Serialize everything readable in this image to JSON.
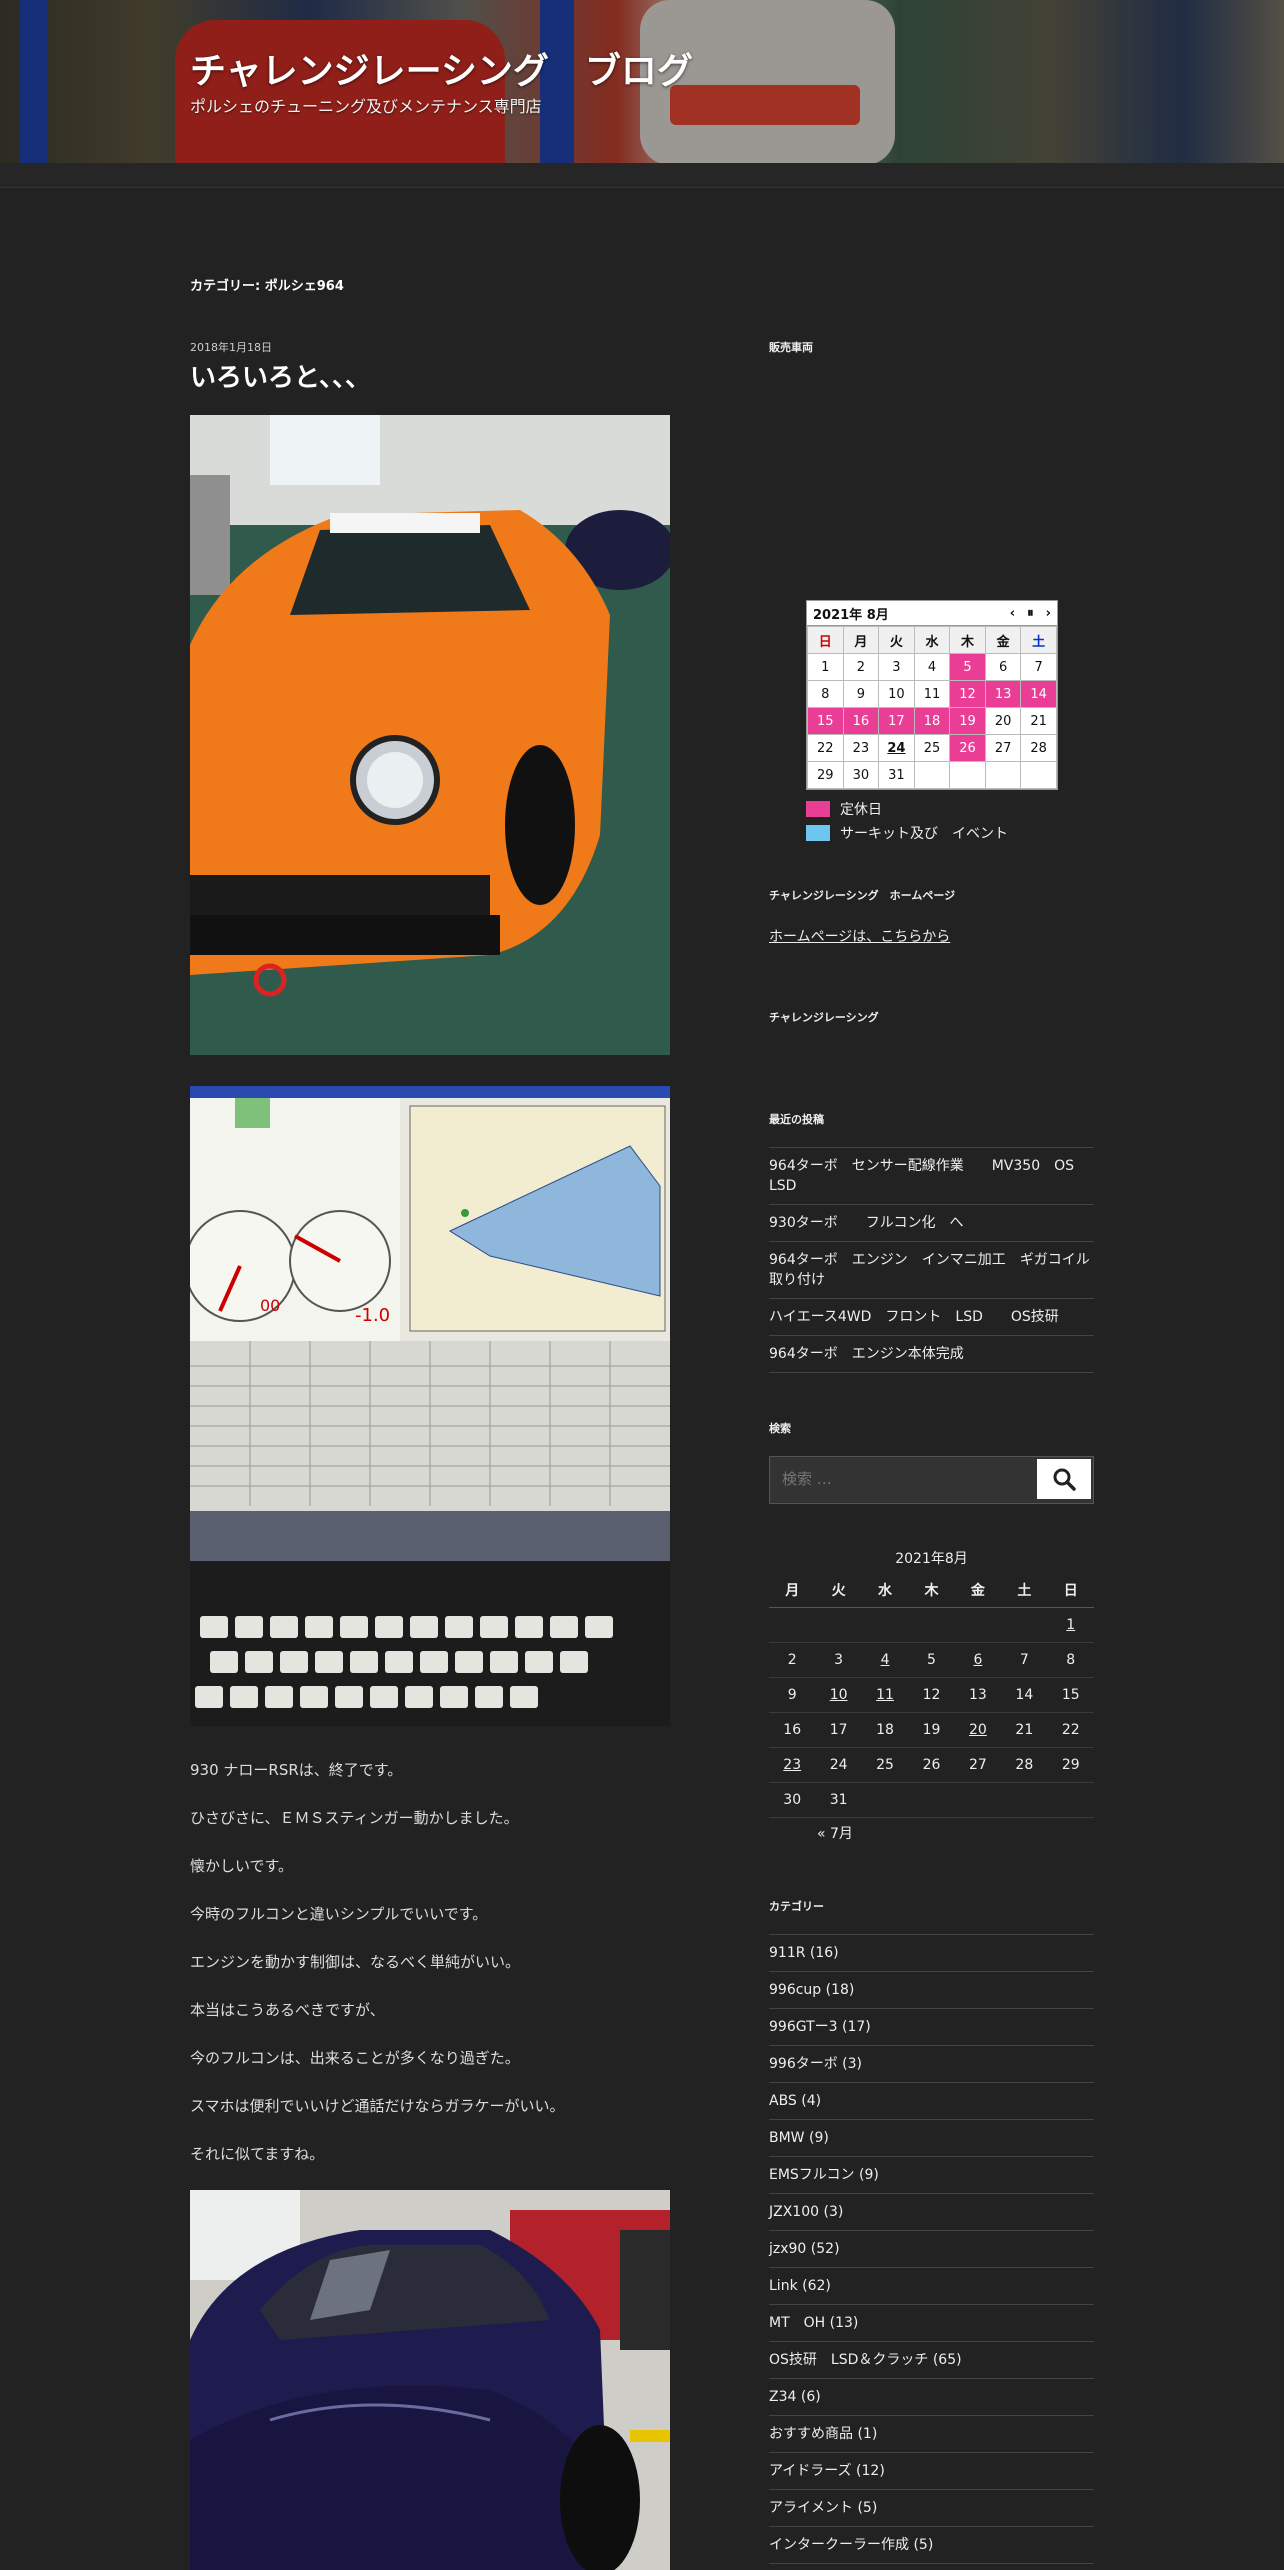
{
  "header": {
    "title": "チャレンジレーシング　ブログ",
    "description": "ポルシェのチューニング及びメンテナンス専門店"
  },
  "archive": {
    "label": "カテゴリー: ポルシェ964"
  },
  "post": {
    "date": "2018年1月18日",
    "title": "いろいろと、、、",
    "paragraphs": [
      "930 ナローRSRは、終了です。",
      "ひさびさに、ＥＭＳスティンガー動かしました。",
      "懐かしいです。",
      "今時のフルコンと違いシンプルでいいです。",
      "エンジンを動かす制御は、なるべく単純がいい。",
      "本当はこうあるべきですが、",
      "今のフルコンは、出来ることが多くなり過ぎた。",
      "スマホは便利でいいけど通話だけならガラケーがいい。",
      "それに似てますね。"
    ]
  },
  "sidebar": {
    "sales_heading": "販売車両",
    "business_calendar": {
      "month_label": "2021年 8月",
      "weekdays": [
        "日",
        "月",
        "火",
        "水",
        "木",
        "金",
        "土"
      ],
      "weeks": [
        [
          "1",
          "2",
          "3",
          "4",
          "5",
          "6",
          "7"
        ],
        [
          "8",
          "9",
          "10",
          "11",
          "12",
          "13",
          "14"
        ],
        [
          "15",
          "16",
          "17",
          "18",
          "19",
          "20",
          "21"
        ],
        [
          "22",
          "23",
          "24",
          "25",
          "26",
          "27",
          "28"
        ],
        [
          "29",
          "30",
          "31",
          "",
          "",
          "",
          ""
        ]
      ],
      "legend": [
        {
          "label": "定休日",
          "color": "#ea3d96"
        },
        {
          "label": "サーキット及び　イベント",
          "color": "#6ec6f0"
        }
      ],
      "holiday_color": "#ea3d96"
    },
    "homepage_heading": "チャレンジレーシング　ホームページ",
    "homepage_link": "ホームページは、こちらから",
    "challenge_heading": "チャレンジレーシング",
    "recent_heading": "最近の投稿",
    "recent_posts": [
      "964ターボ　センサー配線作業　　MV350　OS　LSD",
      "930ターボ　　フルコン化　へ",
      "964ターボ　エンジン　インマニ加工　ギガコイル取り付け",
      "ハイエース4WD　フロント　LSD　　OS技研",
      "964ターボ　エンジン本体完成"
    ],
    "search_heading": "検索",
    "search_placeholder": "検索 …",
    "wp_calendar": {
      "caption": "2021年8月",
      "weekdays": [
        "月",
        "火",
        "水",
        "木",
        "金",
        "土",
        "日"
      ],
      "weeks": [
        [
          "",
          "",
          "",
          "",
          "",
          "",
          "1"
        ],
        [
          "2",
          "3",
          "4",
          "5",
          "6",
          "7",
          "8"
        ],
        [
          "9",
          "10",
          "11",
          "12",
          "13",
          "14",
          "15"
        ],
        [
          "16",
          "17",
          "18",
          "19",
          "20",
          "21",
          "22"
        ],
        [
          "23",
          "24",
          "25",
          "26",
          "27",
          "28",
          "29"
        ],
        [
          "30",
          "31",
          "",
          "",
          "",
          "",
          ""
        ]
      ],
      "linked_days": [
        "1",
        "4",
        "6",
        "10",
        "11",
        "20",
        "23"
      ],
      "prev_link": "« 7月"
    },
    "categories_heading": "カテゴリー",
    "categories": [
      "911R (16)",
      "996cup (18)",
      "996GTー3 (17)",
      "996ターボ (3)",
      "ABS (4)",
      "BMW (9)",
      "EMSフルコン (9)",
      "JZX100 (3)",
      "jzx90 (52)",
      "Link (62)",
      "MT　OH (13)",
      "OS技研　LSD＆クラッチ (65)",
      "Z34 (6)",
      "おすすめ商品 (1)",
      "アイドラーズ (12)",
      "アライメント (5)",
      "インタークーラー作成 (5)"
    ]
  }
}
